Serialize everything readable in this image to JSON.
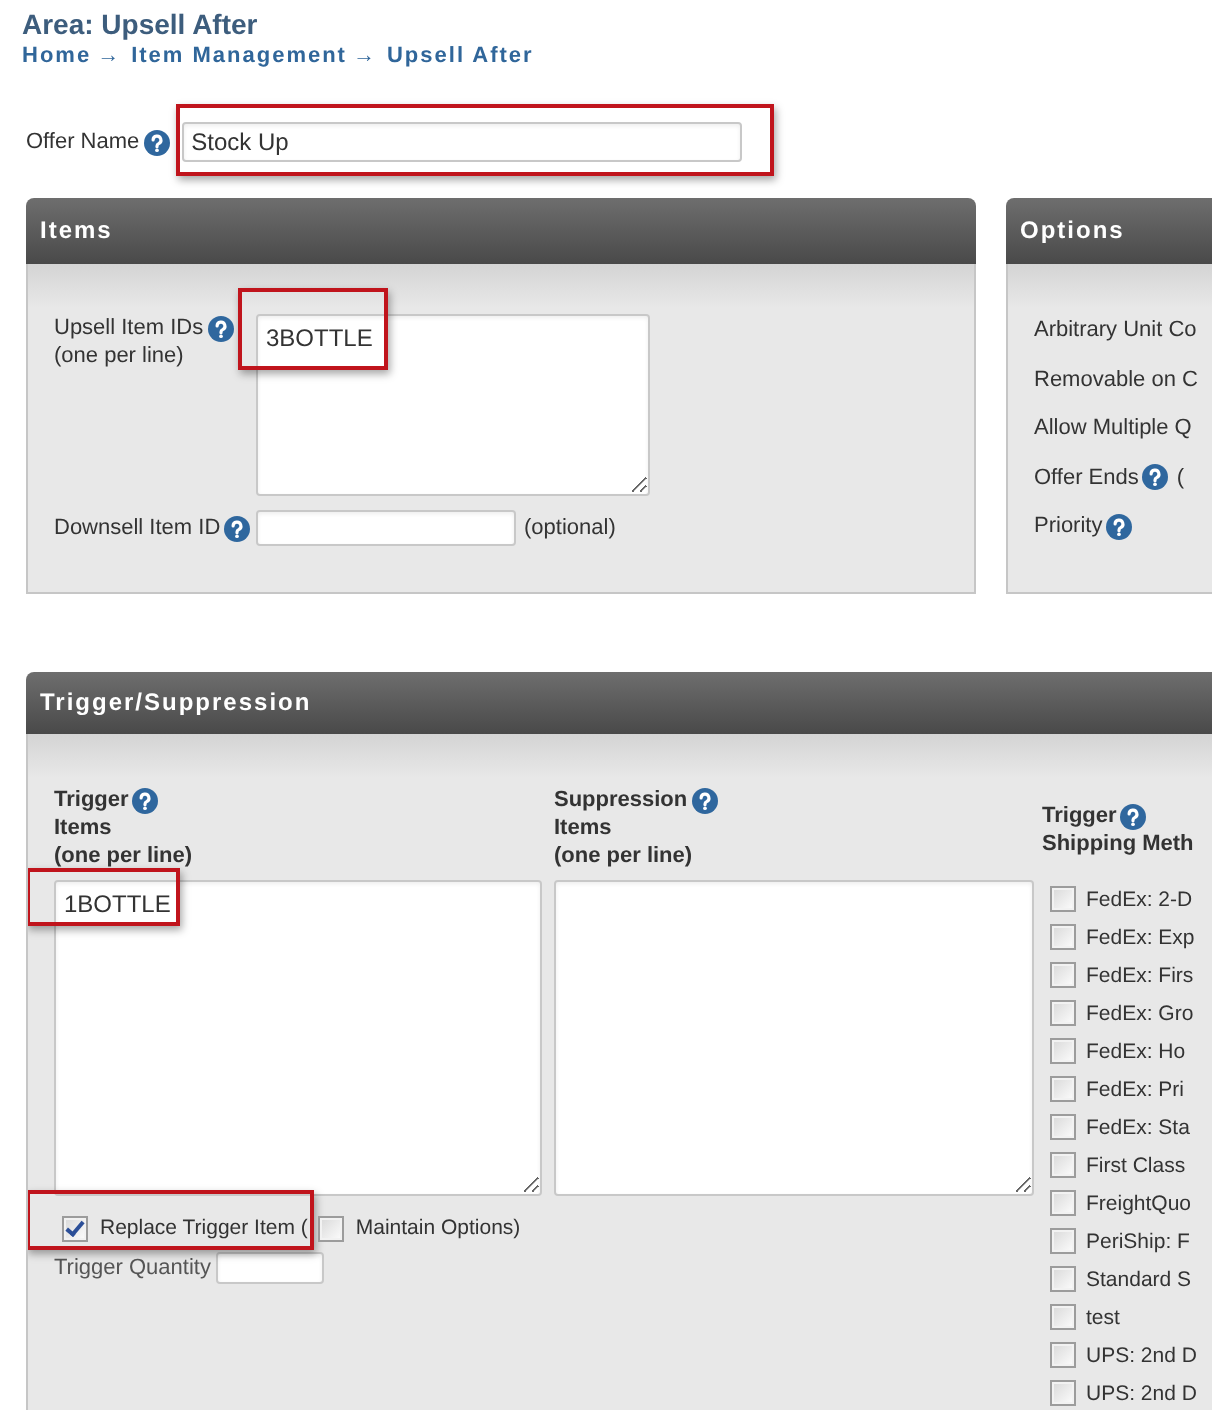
{
  "page": {
    "title": "Area: Upsell After",
    "breadcrumb": [
      {
        "label": "Home",
        "separator": "→"
      },
      {
        "label": "Item Management",
        "separator": "→"
      },
      {
        "label": "Upsell After"
      }
    ]
  },
  "offer_name": {
    "label": "Offer Name",
    "value": "Stock Up",
    "highlighted": true
  },
  "items_panel": {
    "title": "Items",
    "upsell_ids": {
      "label": "Upsell Item IDs",
      "hint": "(one per line)",
      "value": "3BOTTLE",
      "highlighted": true
    },
    "downsell_id": {
      "label": "Downsell Item ID",
      "note": "(optional)"
    }
  },
  "options_panel": {
    "title": "Options",
    "rows": [
      {
        "label": "Arbitrary Unit Co",
        "help": false
      },
      {
        "label": "Removable on C",
        "help": false
      },
      {
        "label": "Allow Multiple Q",
        "help": false
      },
      {
        "label": "Offer Ends",
        "help": true,
        "suffix": "("
      },
      {
        "label": "Priority",
        "help": true
      }
    ]
  },
  "trigger_panel": {
    "title": "Trigger/Suppression",
    "trigger_items": {
      "label": "Trigger",
      "sublabel": "Items",
      "hint": "(one per line)",
      "value": "1BOTTLE",
      "highlighted": true
    },
    "suppression_items": {
      "label": "Suppression",
      "sublabel": "Items",
      "hint": "(one per line)"
    },
    "replace_trigger": {
      "label": "Replace Trigger Item (",
      "checked": true,
      "highlighted": true
    },
    "maintain_options": {
      "label": "Maintain Options)",
      "checked": false
    },
    "trigger_quantity": {
      "label": "Trigger Quantity"
    },
    "shipping": {
      "label": "Trigger",
      "sublabel": "Shipping Meth",
      "methods": [
        {
          "label": "FedEx: 2-D",
          "checked": false
        },
        {
          "label": "FedEx: Exp",
          "checked": false
        },
        {
          "label": "FedEx: Firs",
          "checked": false
        },
        {
          "label": "FedEx: Gro",
          "checked": false
        },
        {
          "label": "FedEx: Ho",
          "checked": false
        },
        {
          "label": "FedEx: Pri",
          "checked": false
        },
        {
          "label": "FedEx: Sta",
          "checked": false
        },
        {
          "label": "First Class",
          "checked": false
        },
        {
          "label": "FreightQuo",
          "checked": false
        },
        {
          "label": "PeriShip: F",
          "checked": false
        },
        {
          "label": "Standard S",
          "checked": false
        },
        {
          "label": "test",
          "checked": false
        },
        {
          "label": "UPS: 2nd D",
          "checked": false
        },
        {
          "label": "UPS: 2nd D",
          "checked": false
        }
      ]
    }
  }
}
